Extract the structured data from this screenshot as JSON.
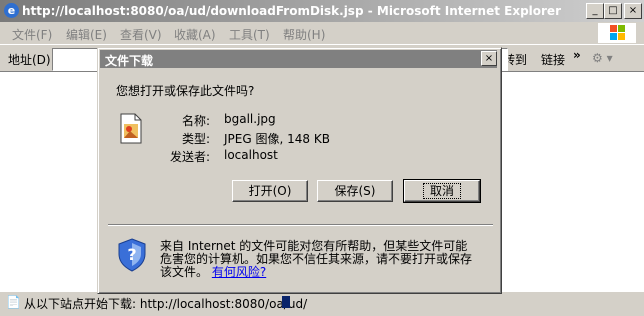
{
  "window": {
    "title": "http://localhost:8080/oa/ud/downloadFromDisk.jsp - Microsoft Internet Explorer",
    "icon": "ie-icon",
    "controls": [
      "_",
      "□",
      "×"
    ]
  },
  "menubar": {
    "items": [
      "文件(F)",
      "编辑(E)",
      "查看(V)",
      "收藏(A)",
      "工具(T)",
      "帮助(H)"
    ]
  },
  "addressbar": {
    "label": "地址(D)",
    "value": "",
    "go_label": "转到",
    "links_label": "链接",
    "chevron": "»"
  },
  "statusbar": {
    "text": "从以下站点开始下载: http://localhost:8080/oa/ud/"
  },
  "dialog": {
    "title": "文件下载",
    "close": "×",
    "question": "您想打开或保存此文件吗?",
    "name_label": "名称:",
    "name_value": "bgall.jpg",
    "type_label": "类型:",
    "type_value": "JPEG 图像, 148 KB",
    "from_label": "发送者:",
    "from_value": "localhost",
    "open_button": "打开(O)",
    "save_button": "保存(S)",
    "cancel_button": "取消",
    "warning_line1": "来自 Internet 的文件可能对您有所帮助，但某些文件可能",
    "warning_line2": "危害您的计算机。如果您不信任其来源，请不要打开或保存",
    "warning_line3": "该文件。",
    "risk_link": "有何风险?"
  },
  "colors": {
    "title_active": "#0a246a",
    "title_inactive": "#808080",
    "face": "#d4d0c8",
    "link": "#0000ee"
  }
}
